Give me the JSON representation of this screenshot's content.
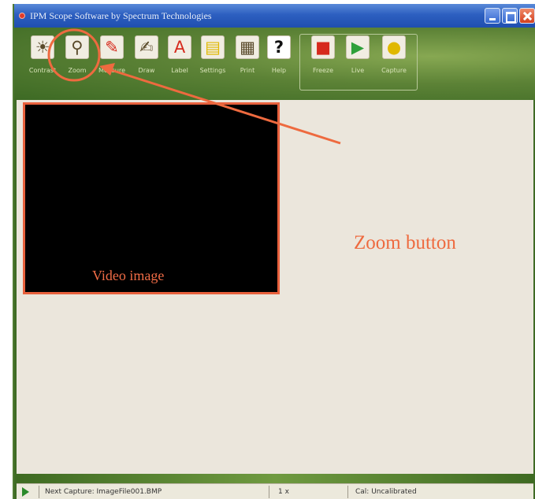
{
  "window": {
    "title": "IPM Scope Software by Spectrum Technologies"
  },
  "toolbar": {
    "tools": [
      {
        "label": "Contrast",
        "icon": "contrast-bulb-icon",
        "glyph": "☀"
      },
      {
        "label": "Zoom",
        "icon": "zoom-magnifier-icon",
        "glyph": "⚲"
      },
      {
        "label": "Measure",
        "icon": "measure-icon",
        "glyph": "✎"
      },
      {
        "label": "Draw",
        "icon": "draw-hand-icon",
        "glyph": "✍"
      },
      {
        "label": "Label",
        "icon": "label-letter-icon",
        "glyph": "A"
      },
      {
        "label": "Settings",
        "icon": "settings-folder-icon",
        "glyph": "▤"
      },
      {
        "label": "Print",
        "icon": "printer-icon",
        "glyph": "▦"
      },
      {
        "label": "Help",
        "icon": "help-icon",
        "glyph": "?"
      }
    ],
    "capture_tools": [
      {
        "label": "Freeze",
        "icon": "stop-square-icon",
        "glyph": "■",
        "color": "#d62a1d"
      },
      {
        "label": "Live",
        "icon": "play-triangle-icon",
        "glyph": "▶",
        "color": "#2ea03a"
      },
      {
        "label": "Capture",
        "icon": "capture-ball-icon",
        "glyph": "●",
        "color": "#e0b800"
      }
    ]
  },
  "annotations": {
    "zoom_button_callout": "Zoom button",
    "video_image_label": "Video image",
    "accent_color": "#ee6a3f"
  },
  "statusbar": {
    "next_capture": "Next Capture: ImageFile001.BMP",
    "zoom": "1 x",
    "calibration": "Cal: Uncalibrated"
  }
}
